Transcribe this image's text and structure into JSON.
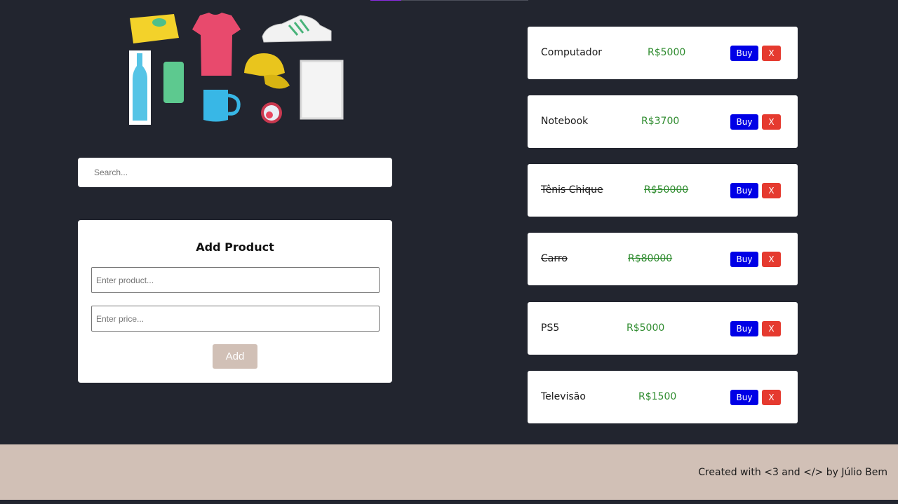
{
  "search": {
    "placeholder": "Search..."
  },
  "add_form": {
    "title": "Add Product",
    "product_placeholder": "Enter product...",
    "price_placeholder": "Enter price...",
    "add_label": "Add"
  },
  "products": [
    {
      "name": "Computador",
      "price": "R$5000",
      "purchased": false,
      "buy_label": "Buy",
      "remove_label": "X"
    },
    {
      "name": "Notebook",
      "price": "R$3700",
      "purchased": false,
      "buy_label": "Buy",
      "remove_label": "X"
    },
    {
      "name": "Tênis Chique",
      "price": "R$50000",
      "purchased": true,
      "buy_label": "Buy",
      "remove_label": "X"
    },
    {
      "name": "Carro",
      "price": "R$80000",
      "purchased": true,
      "buy_label": "Buy",
      "remove_label": "X"
    },
    {
      "name": "PS5",
      "price": "R$5000",
      "purchased": false,
      "buy_label": "Buy",
      "remove_label": "X"
    },
    {
      "name": "Televisão",
      "price": "R$1500",
      "purchased": false,
      "buy_label": "Buy",
      "remove_label": "X"
    }
  ],
  "footer": {
    "text": "Created with <3 and </> by Júlio Bem"
  },
  "colors": {
    "background": "#22252f",
    "accent_footer": "#d1c0b6",
    "price": "#2e8b2e",
    "buy_button": "#0000e6",
    "remove_button": "#e53a2f"
  }
}
